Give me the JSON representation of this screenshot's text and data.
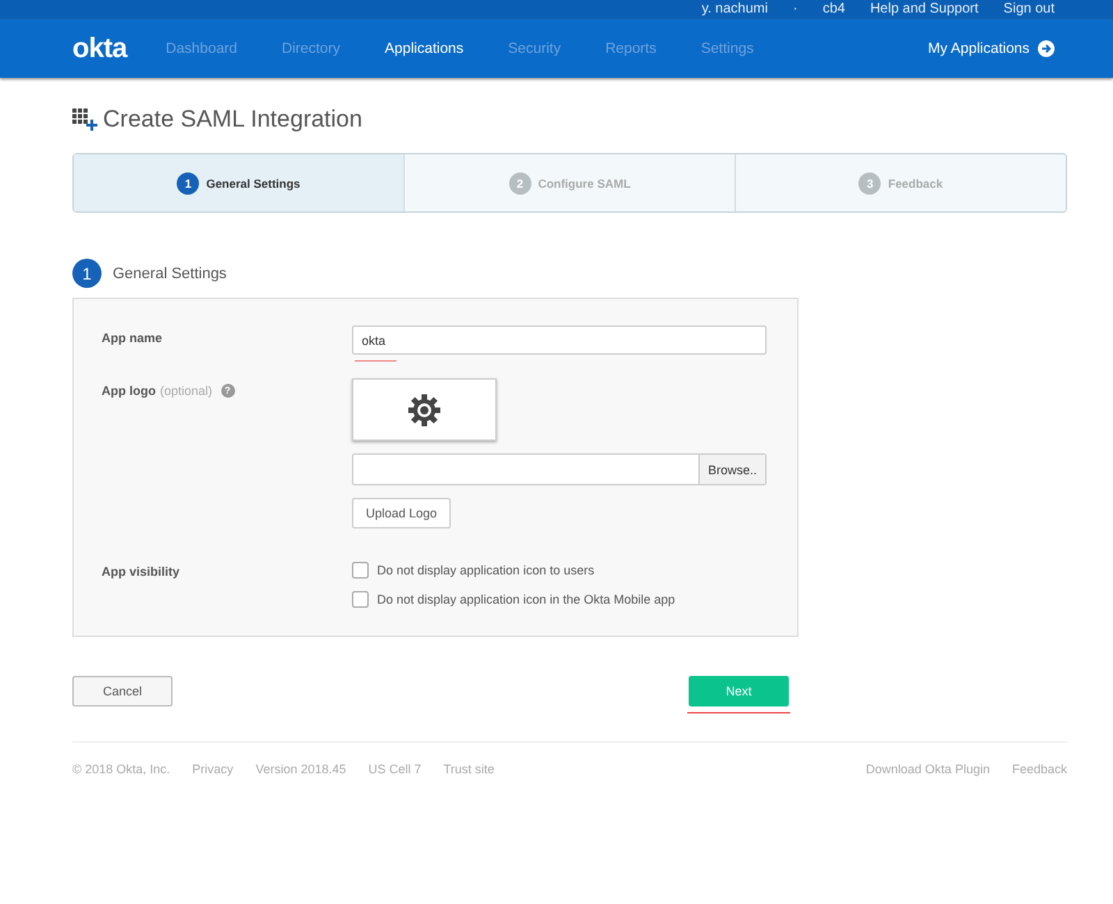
{
  "top_bar": {
    "user": "y. nachumi",
    "separator": "·",
    "org": "cb4",
    "help": "Help and Support",
    "sign_out": "Sign out"
  },
  "nav": {
    "logo": "okta",
    "items": [
      {
        "label": "Dashboard",
        "selected": false
      },
      {
        "label": "Directory",
        "selected": false
      },
      {
        "label": "Applications",
        "selected": true
      },
      {
        "label": "Security",
        "selected": false
      },
      {
        "label": "Reports",
        "selected": false
      },
      {
        "label": "Settings",
        "selected": false
      }
    ],
    "my_apps": "My Applications"
  },
  "page_title": "Create SAML Integration",
  "steps": [
    {
      "number": "1",
      "label": "General Settings",
      "selected": true
    },
    {
      "number": "2",
      "label": "Configure SAML",
      "selected": false
    },
    {
      "number": "3",
      "label": "Feedback",
      "selected": false
    }
  ],
  "section": {
    "number": "1",
    "title": "General Settings"
  },
  "form": {
    "app_name_label": "App name",
    "app_name_value": "okta",
    "app_logo_label": "App logo",
    "app_logo_hint": "(optional)",
    "help_mark": "?",
    "browse": "Browse..",
    "upload": "Upload Logo",
    "visibility_label": "App visibility",
    "options": [
      {
        "label": "Do not display application icon to users",
        "checked": false
      },
      {
        "label": "Do not display application icon in the Okta Mobile app",
        "checked": false
      }
    ]
  },
  "buttons": {
    "cancel": "Cancel",
    "next": "Next"
  },
  "footer": {
    "left": [
      "© 2018 Okta, Inc.",
      "Privacy",
      "Version 2018.45",
      "US Cell 7",
      "Trust site"
    ],
    "right": [
      "Download Okta Plugin",
      "Feedback"
    ]
  }
}
